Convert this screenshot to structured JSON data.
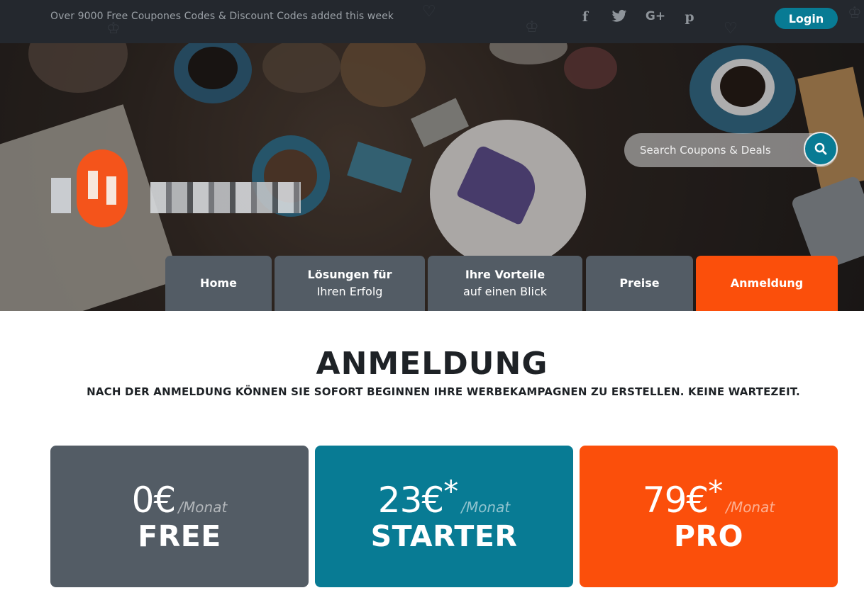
{
  "colors": {
    "topbar_bg": "#24282e",
    "accent_teal": "#087b94",
    "accent_orange": "#fb4f0b",
    "nav_gray": "#535c65",
    "dark_text": "#1e2226"
  },
  "topbar": {
    "promo_text": "Over 9000 Free Coupones Codes & Discount Codes added this week",
    "social": [
      {
        "name": "facebook-icon",
        "glyph": "f"
      },
      {
        "name": "twitter-icon",
        "glyph": "🐦"
      },
      {
        "name": "google-plus-icon",
        "glyph": "G+"
      },
      {
        "name": "pinterest-icon",
        "glyph": "p"
      }
    ],
    "login_label": "Login"
  },
  "hero": {
    "search": {
      "placeholder": "Search Coupons & Deals",
      "button_icon": "search-icon"
    }
  },
  "nav": {
    "tabs": [
      {
        "line1": "Home",
        "line2": ""
      },
      {
        "line1": "Lösungen für",
        "line2": "Ihren Erfolg"
      },
      {
        "line1": "Ihre Vorteile",
        "line2": "auf einen Blick"
      },
      {
        "line1": "Preise",
        "line2": ""
      },
      {
        "line1": "Anmeldung",
        "line2": "",
        "active": true
      }
    ]
  },
  "main": {
    "title": "ANMELDUNG",
    "subtitle": "NACH DER ANMELDUNG KÖNNEN SIE SOFORT BEGINNEN IHRE WERBEKAMPAGNEN ZU ERSTELLEN. KEINE WARTEZEIT.",
    "plans": [
      {
        "price": "0€",
        "asterisk": "",
        "per": "/Monat",
        "name": "FREE",
        "color": "#535c65"
      },
      {
        "price": "23€",
        "asterisk": "*",
        "per": "/Monat",
        "name": "STARTER",
        "color": "#087b94"
      },
      {
        "price": "79€",
        "asterisk": "*",
        "per": "/Monat",
        "name": "PRO",
        "color": "#fb4f0b"
      }
    ]
  }
}
